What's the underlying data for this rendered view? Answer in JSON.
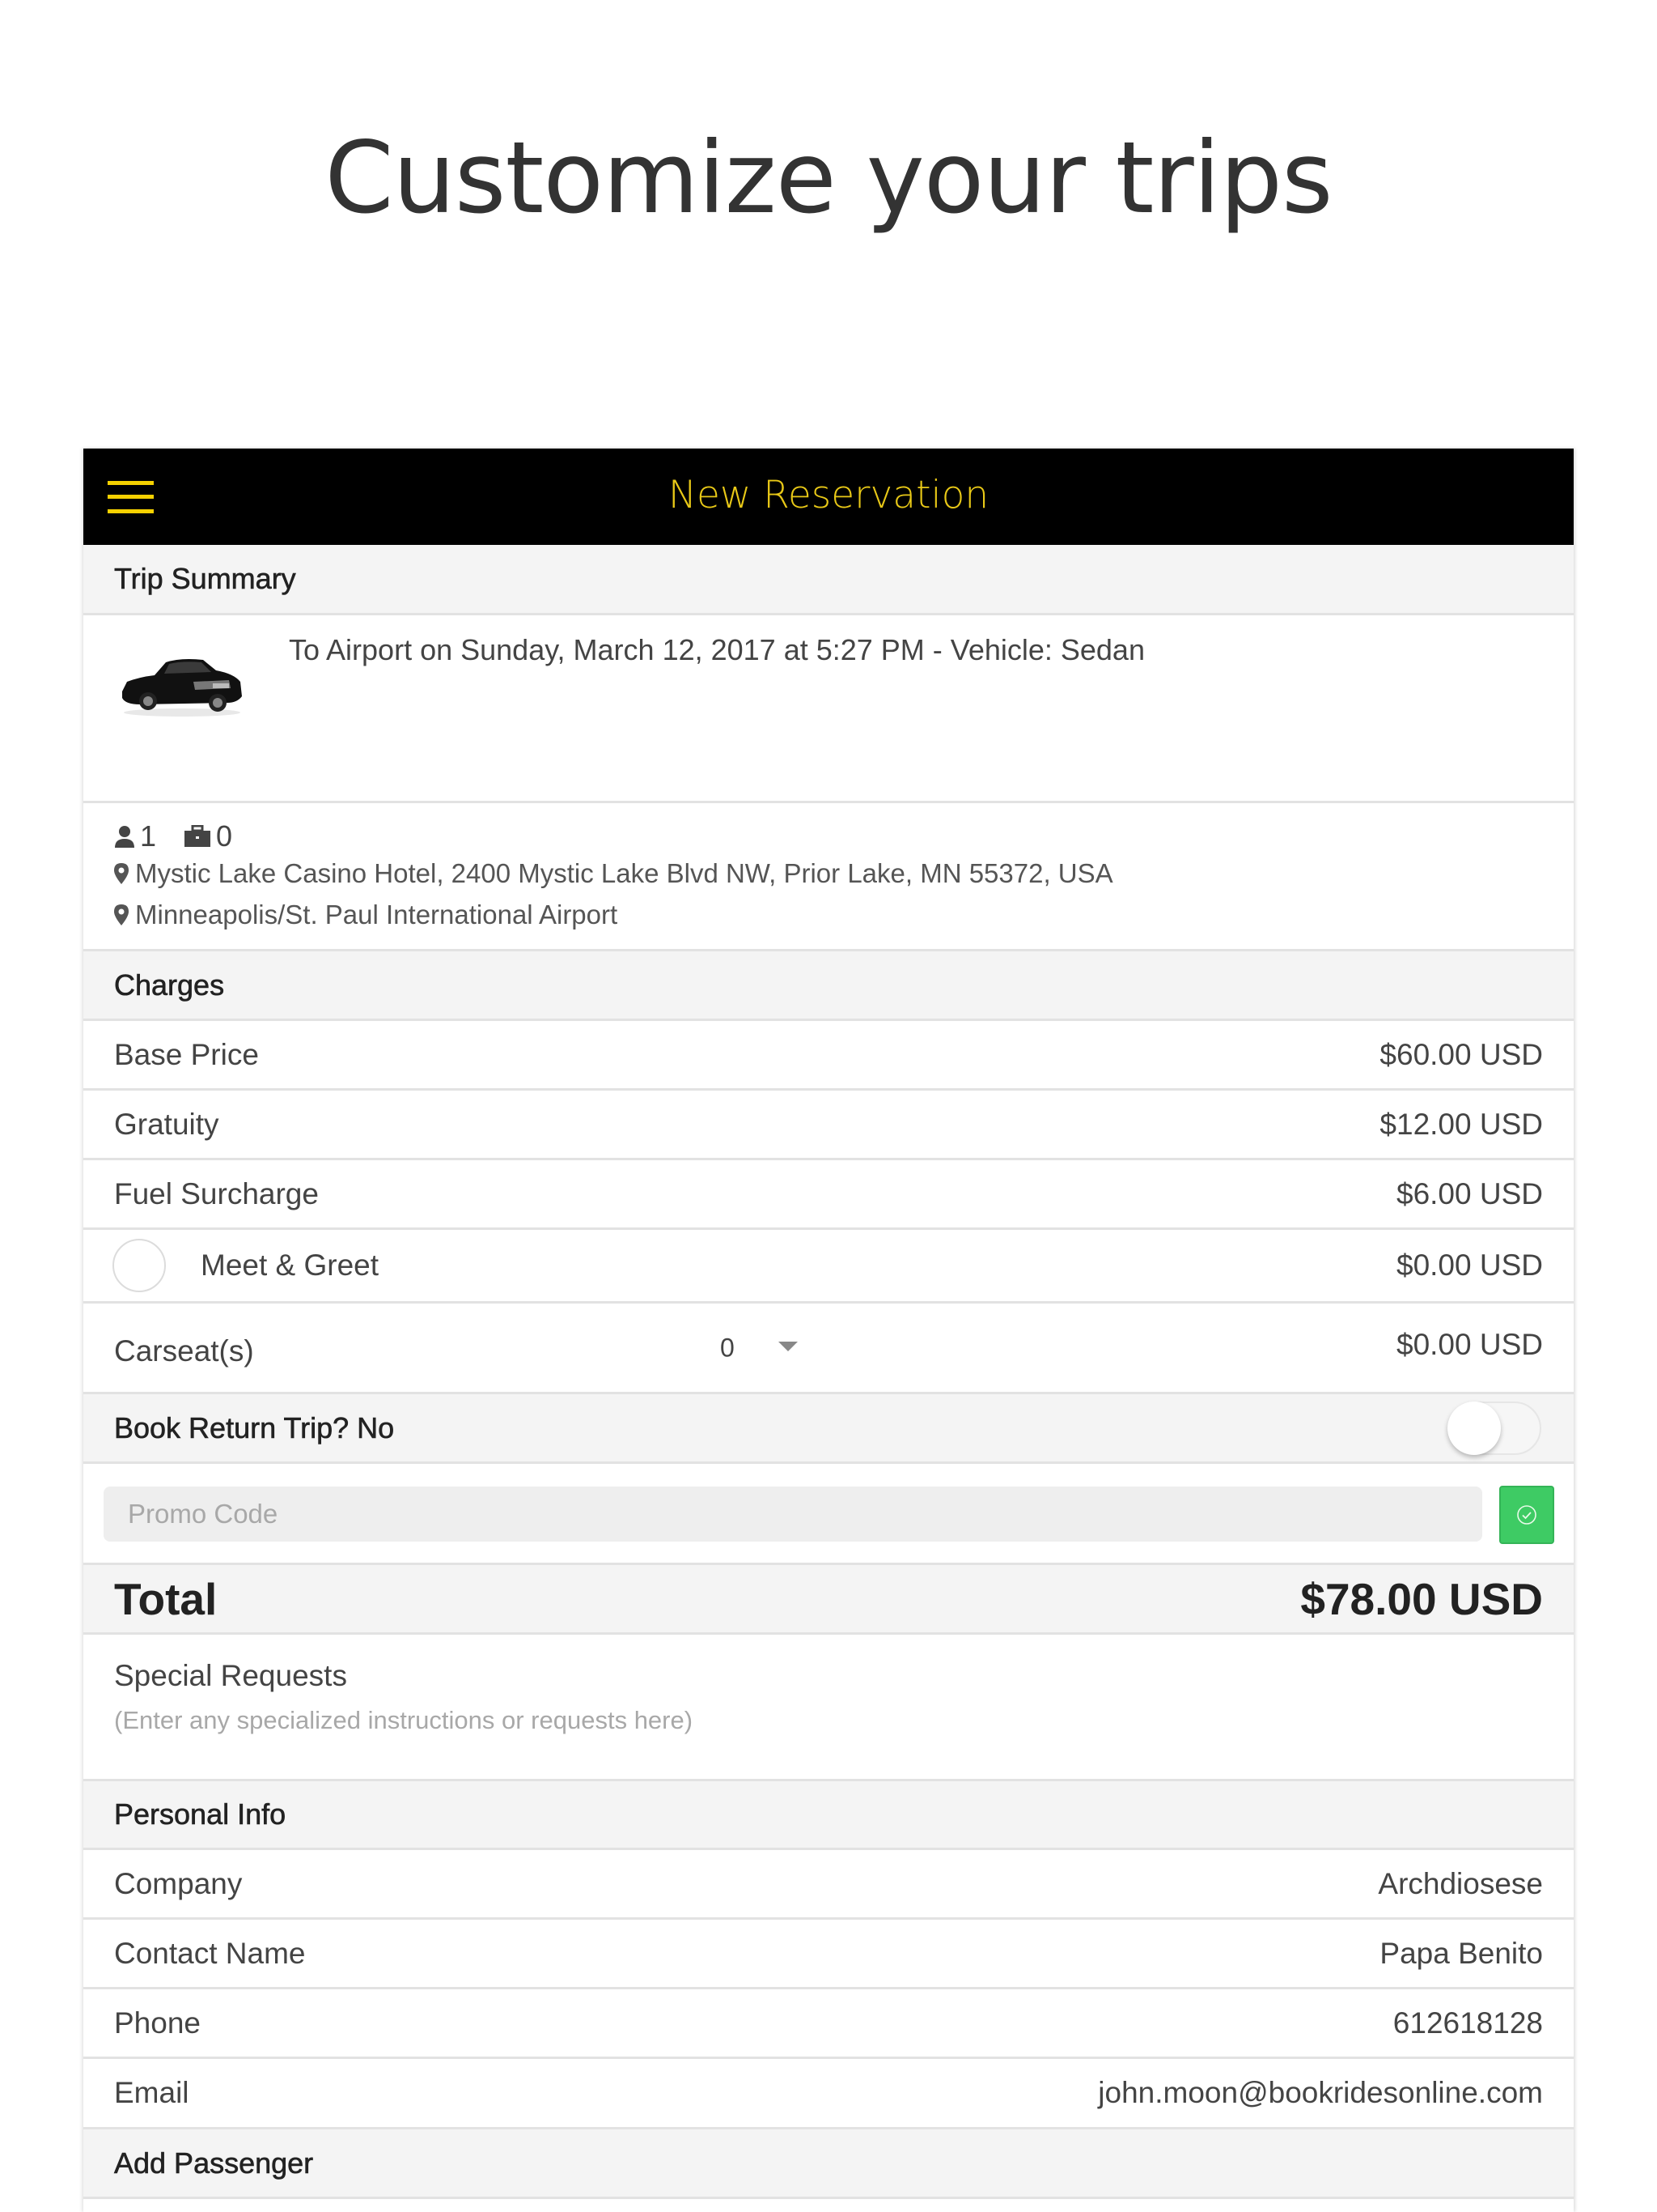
{
  "hero": {
    "title": "Customize your trips"
  },
  "appbar": {
    "title": "New Reservation",
    "menu_icon": "hamburger-menu-icon",
    "accent_color": "#e8c817"
  },
  "trip_summary": {
    "heading": "Trip Summary",
    "description": "To Airport on Sunday, March 12, 2017 at 5:27 PM - Vehicle: Sedan",
    "vehicle_image": "sedan-car-image",
    "passengers": "1",
    "luggage": "0",
    "pickup": "Mystic Lake Casino Hotel, 2400 Mystic Lake Blvd NW, Prior Lake, MN 55372, USA",
    "dropoff": "Minneapolis/St. Paul International Airport"
  },
  "charges": {
    "heading": "Charges",
    "items": [
      {
        "label": "Base Price",
        "value": "$60.00 USD"
      },
      {
        "label": "Gratuity",
        "value": "$12.00 USD"
      },
      {
        "label": "Fuel Surcharge",
        "value": "$6.00 USD"
      }
    ],
    "meet_greet": {
      "label": "Meet & Greet",
      "value": "$0.00 USD",
      "checked": false
    },
    "carseat": {
      "label": "Carseat(s)",
      "selected": "0",
      "value": "$0.00 USD"
    }
  },
  "return_trip": {
    "label": "Book Return Trip? No",
    "enabled": false
  },
  "promo": {
    "placeholder": "Promo Code",
    "value": "",
    "apply_color": "#3ecb64"
  },
  "total": {
    "label": "Total",
    "value": "$78.00 USD"
  },
  "special_requests": {
    "label": "Special Requests",
    "placeholder": "(Enter any specialized instructions or requests here)"
  },
  "personal_info": {
    "heading": "Personal Info",
    "fields": [
      {
        "label": "Company",
        "value": "Archdiosese"
      },
      {
        "label": "Contact Name",
        "value": "Papa Benito"
      },
      {
        "label": "Phone",
        "value": "612618128"
      },
      {
        "label": "Email",
        "value": "john.moon@bookridesonline.com"
      }
    ]
  },
  "add_passenger": {
    "heading": "Add Passenger"
  }
}
